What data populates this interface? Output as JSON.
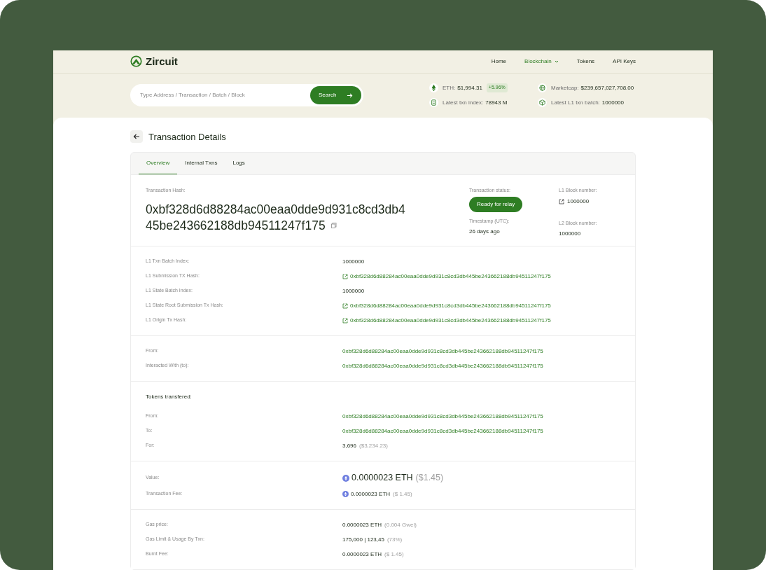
{
  "logo": {
    "name": "Zircuit"
  },
  "nav": [
    {
      "label": "Home",
      "selected": false,
      "dropdown": false
    },
    {
      "label": "Blockchain",
      "selected": true,
      "dropdown": true
    },
    {
      "label": "Tokens",
      "selected": false,
      "dropdown": false
    },
    {
      "label": "API Keys",
      "selected": false,
      "dropdown": false
    }
  ],
  "search": {
    "placeholder": "Type Address / Transaction / Batch / Block",
    "button": "Search"
  },
  "stats": [
    {
      "kind": "eth",
      "label": "ETH:",
      "value": "$1,994.31",
      "badge": "+5.96%"
    },
    {
      "kind": "globe",
      "label": "Marketcap:",
      "value": "$239,657,027,708.00"
    },
    {
      "kind": "doc",
      "label": "Latest txn index:",
      "value": "78943 M"
    },
    {
      "kind": "cube",
      "label": "Latest L1 txn batch:",
      "value": "1000000"
    }
  ],
  "page_title": "Transaction Details",
  "tabs": [
    {
      "label": "Overview",
      "selected": true
    },
    {
      "label": "Internal Txns",
      "selected": false
    },
    {
      "label": "Logs",
      "selected": false
    }
  ],
  "summary": {
    "hash_label": "Transaction Hash:",
    "hash_lines": [
      "0xbf328d6d88284ac00eaa0dde9d931c8cd3db4",
      "45be243662188db94511247f175"
    ],
    "status_label": "Transaction status:",
    "status": "Ready for relay",
    "timestamp_label": "Timestamp (UTC):",
    "timestamp": "26 days ago",
    "l1_label": "L1 Block number:",
    "l1_value": "1000000",
    "l2_label": "L2 Block number:",
    "l2_value": "1000000"
  },
  "sections": [
    {
      "rows": [
        {
          "label": "L1 Txn Batch Index:",
          "kind": "text",
          "value": "1000000"
        },
        {
          "label": "L1 Submission TX Hash:",
          "kind": "external",
          "value": "0xbf328d6d88284ac00eaa0dde9d931c8cd3db445be243662188db94511247f175"
        },
        {
          "label": "L1 State Batch Index:",
          "kind": "text",
          "value": "1000000"
        },
        {
          "label": "L1 State Root Submission Tx Hash:",
          "kind": "external",
          "value": "0xbf328d6d88284ac00eaa0dde9d931c8cd3db445be243662188db94511247f175"
        },
        {
          "label": "L1 Origin Tx Hash:",
          "kind": "external",
          "value": "0xbf328d6d88284ac00eaa0dde9d931c8cd3db445be243662188db94511247f175"
        }
      ]
    },
    {
      "rows": [
        {
          "label": "From:",
          "kind": "link",
          "value": "0xbf328d6d88284ac00eaa0dde9d931c8cd3db445be243662188db94511247f175"
        },
        {
          "label": "Interacted With (to):",
          "kind": "link",
          "value": "0xbf328d6d88284ac00eaa0dde9d931c8cd3db445be243662188db94511247f175"
        }
      ]
    },
    {
      "title": "Tokens transfered:",
      "rows": [
        {
          "label": "From:",
          "kind": "link",
          "value": "0xbf328d6d88284ac00eaa0dde9d931c8cd3db445be243662188db94511247f175"
        },
        {
          "label": "To:",
          "kind": "link",
          "value": "0xbf328d6d88284ac00eaa0dde9d931c8cd3db445be243662188db94511247f175"
        },
        {
          "label": "For:",
          "kind": "text",
          "value": "3,696",
          "secondary": "($3,234.23)"
        }
      ]
    },
    {
      "rows": [
        {
          "label": "Value:",
          "kind": "eth_large",
          "value": "0.0000023 ETH",
          "secondary": "($1.45)"
        },
        {
          "label": "Transaction Fee:",
          "kind": "eth",
          "value": "0.0000023 ETH",
          "secondary": "($ 1.45)"
        }
      ]
    },
    {
      "rows": [
        {
          "label": "Gas price:",
          "kind": "text",
          "value": "0.0000023 ETH",
          "secondary": "(0.004 Gwei)"
        },
        {
          "label": "Gas Limit & Usage By Txn:",
          "kind": "text",
          "value": "175,000 | 123,45",
          "secondary": "(73%)"
        },
        {
          "label": "Burnt Fee:",
          "kind": "text",
          "value": "0.0000023 ETH",
          "secondary": "($ 1.45)"
        }
      ]
    }
  ]
}
